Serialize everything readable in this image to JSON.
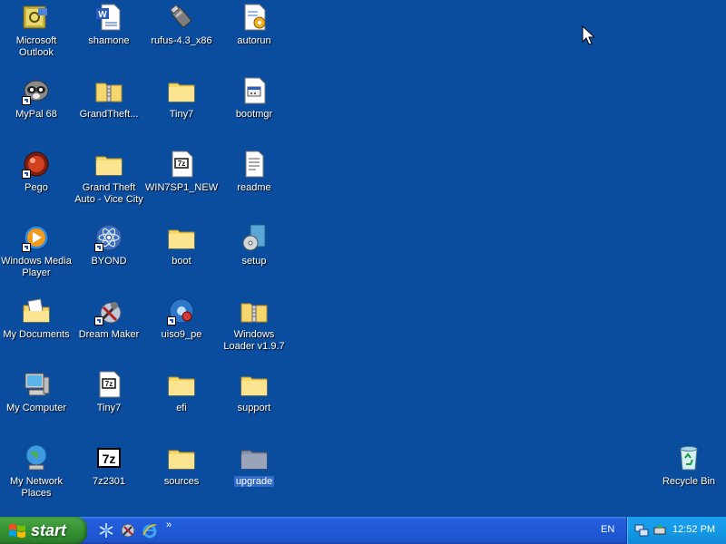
{
  "desktop": {
    "icons": [
      {
        "label": "Microsoft Outlook",
        "icon": "outlook-icon"
      },
      {
        "label": "shamone",
        "icon": "word-document-icon"
      },
      {
        "label": "rufus-4.3_x86",
        "icon": "usb-drive-icon"
      },
      {
        "label": "autorun",
        "icon": "config-file-icon"
      },
      {
        "label": "MyPal 68",
        "icon": "raccoon-browser-icon"
      },
      {
        "label": "GrandTheft...",
        "icon": "zip-folder-icon"
      },
      {
        "label": "Tiny7",
        "icon": "folder-icon"
      },
      {
        "label": "bootmgr",
        "icon": "system-file-icon"
      },
      {
        "label": "Pego",
        "icon": "red-ball-app-icon"
      },
      {
        "label": "Grand Theft Auto - Vice City",
        "icon": "folder-icon"
      },
      {
        "label": "WIN7SP1_NEW",
        "icon": "7z-archive-icon"
      },
      {
        "label": "readme",
        "icon": "text-file-icon"
      },
      {
        "label": "Windows Media Player",
        "icon": "media-player-icon"
      },
      {
        "label": "BYOND",
        "icon": "atom-icon"
      },
      {
        "label": "boot",
        "icon": "folder-icon"
      },
      {
        "label": "setup",
        "icon": "installer-icon"
      },
      {
        "label": "My Documents",
        "icon": "my-documents-icon"
      },
      {
        "label": "Dream Maker",
        "icon": "tools-icon"
      },
      {
        "label": "uiso9_pe",
        "icon": "ultraiso-icon"
      },
      {
        "label": "Windows Loader v1.9.7",
        "icon": "zip-folder-icon"
      },
      {
        "label": "My Computer",
        "icon": "computer-icon"
      },
      {
        "label": "Tiny7",
        "icon": "7z-archive-icon"
      },
      {
        "label": "efi",
        "icon": "folder-icon"
      },
      {
        "label": "support",
        "icon": "folder-icon"
      },
      {
        "label": "My Network Places",
        "icon": "network-globe-icon"
      },
      {
        "label": "7z2301",
        "icon": "7zip-icon"
      },
      {
        "label": "sources",
        "icon": "folder-icon"
      },
      {
        "label": "upgrade",
        "icon": "folder-icon"
      }
    ],
    "recycle_bin": {
      "label": "Recycle Bin",
      "icon": "recycle-bin-icon"
    }
  },
  "taskbar": {
    "start_label": "start",
    "quick_launch": [
      {
        "icon": "snowflake-icon"
      },
      {
        "icon": "dream-maker-icon"
      },
      {
        "icon": "internet-explorer-icon"
      }
    ],
    "chevron": "»",
    "language": "EN",
    "clock": "12:52 PM"
  }
}
